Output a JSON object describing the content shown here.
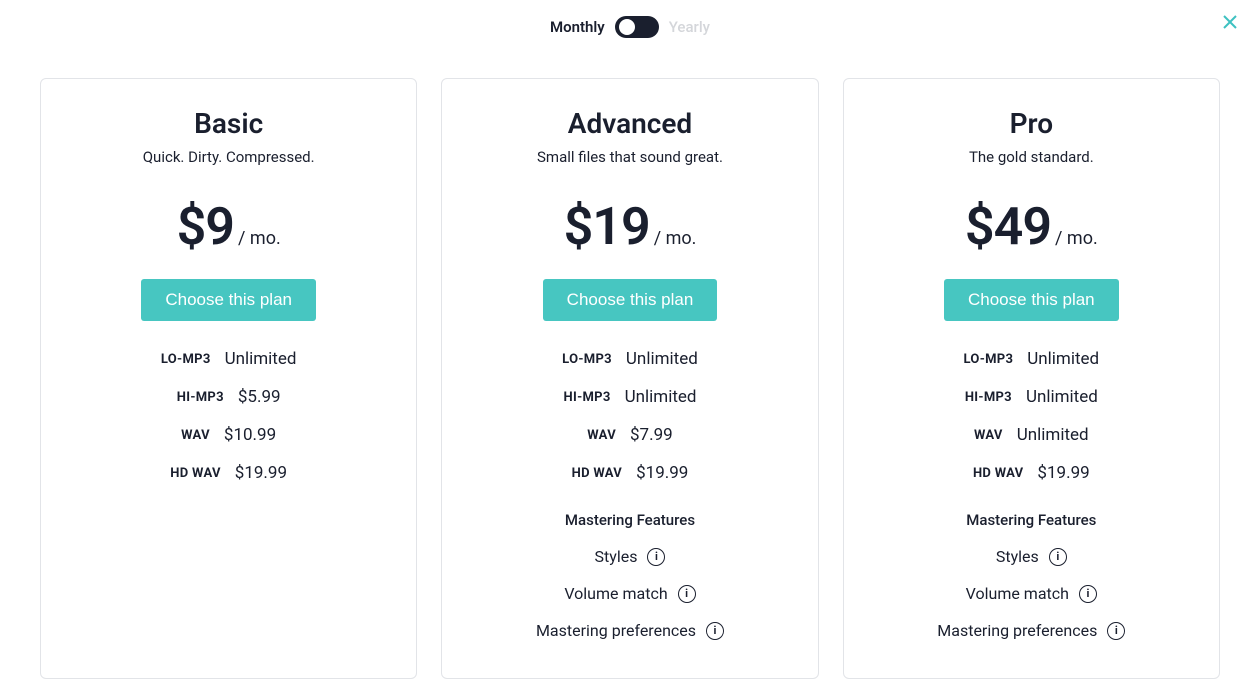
{
  "header": {
    "monthly_label": "Monthly",
    "yearly_label": "Yearly"
  },
  "cta_label": "Choose this plan",
  "plans": [
    {
      "name": "Basic",
      "tagline": "Quick. Dirty. Compressed.",
      "price": "$9",
      "period": "/ mo.",
      "features": [
        {
          "key": "LO-MP3",
          "val": "Unlimited"
        },
        {
          "key": "HI-MP3",
          "val": "$5.99"
        },
        {
          "key": "WAV",
          "val": "$10.99"
        },
        {
          "key": "HD WAV",
          "val": "$19.99"
        }
      ],
      "has_mastering": false
    },
    {
      "name": "Advanced",
      "tagline": "Small files that sound great.",
      "price": "$19",
      "period": "/ mo.",
      "features": [
        {
          "key": "LO-MP3",
          "val": "Unlimited"
        },
        {
          "key": "HI-MP3",
          "val": "Unlimited"
        },
        {
          "key": "WAV",
          "val": "$7.99"
        },
        {
          "key": "HD WAV",
          "val": "$19.99"
        }
      ],
      "has_mastering": true
    },
    {
      "name": "Pro",
      "tagline": "The gold standard.",
      "price": "$49",
      "period": "/ mo.",
      "features": [
        {
          "key": "LO-MP3",
          "val": "Unlimited"
        },
        {
          "key": "HI-MP3",
          "val": "Unlimited"
        },
        {
          "key": "WAV",
          "val": "Unlimited"
        },
        {
          "key": "HD WAV",
          "val": "$19.99"
        }
      ],
      "has_mastering": true
    }
  ],
  "mastering": {
    "heading": "Mastering Features",
    "items": [
      "Styles",
      "Volume match",
      "Mastering preferences"
    ]
  }
}
